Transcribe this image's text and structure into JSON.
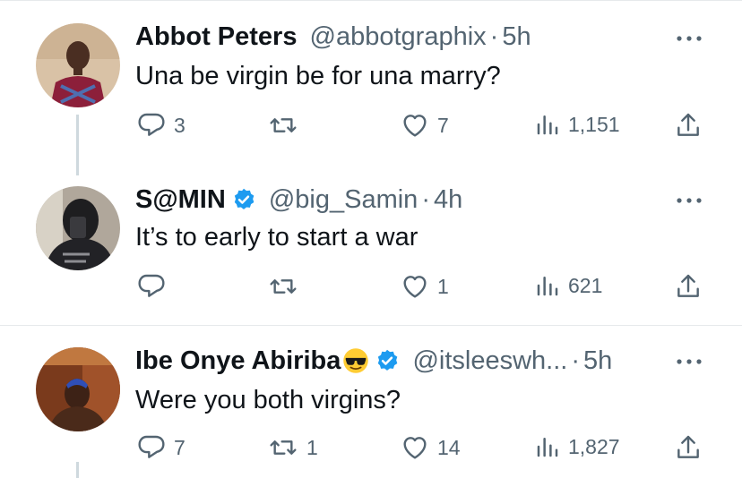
{
  "colors": {
    "text": "#0f1419",
    "muted": "#536471",
    "verified": "#1d9bf0",
    "divider": "#e6e9eb",
    "thread": "#cfd9de"
  },
  "replies": [
    {
      "name": "Abbot Peters",
      "handle": "@abbotgraphix",
      "dot": "·",
      "time": "5h",
      "verified": false,
      "text": "Una be virgin be for una marry?",
      "reply_count": "3",
      "retweet_count": "",
      "like_count": "7",
      "view_count": "1,151"
    },
    {
      "name": "S@MIN",
      "handle": "@big_Samin",
      "dot": "·",
      "time": "4h",
      "verified": true,
      "text": "It’s to early to start a war",
      "reply_count": "",
      "retweet_count": "",
      "like_count": "1",
      "view_count": "621"
    },
    {
      "name": "Ibe Onye Abiriba",
      "name_emoji": "smiling-face-with-sunglasses",
      "handle": "@itsleeswh...",
      "dot": "·",
      "time": "5h",
      "verified": true,
      "text": "Were you both virgins?",
      "reply_count": "7",
      "retweet_count": "1",
      "like_count": "14",
      "view_count": "1,827"
    }
  ]
}
